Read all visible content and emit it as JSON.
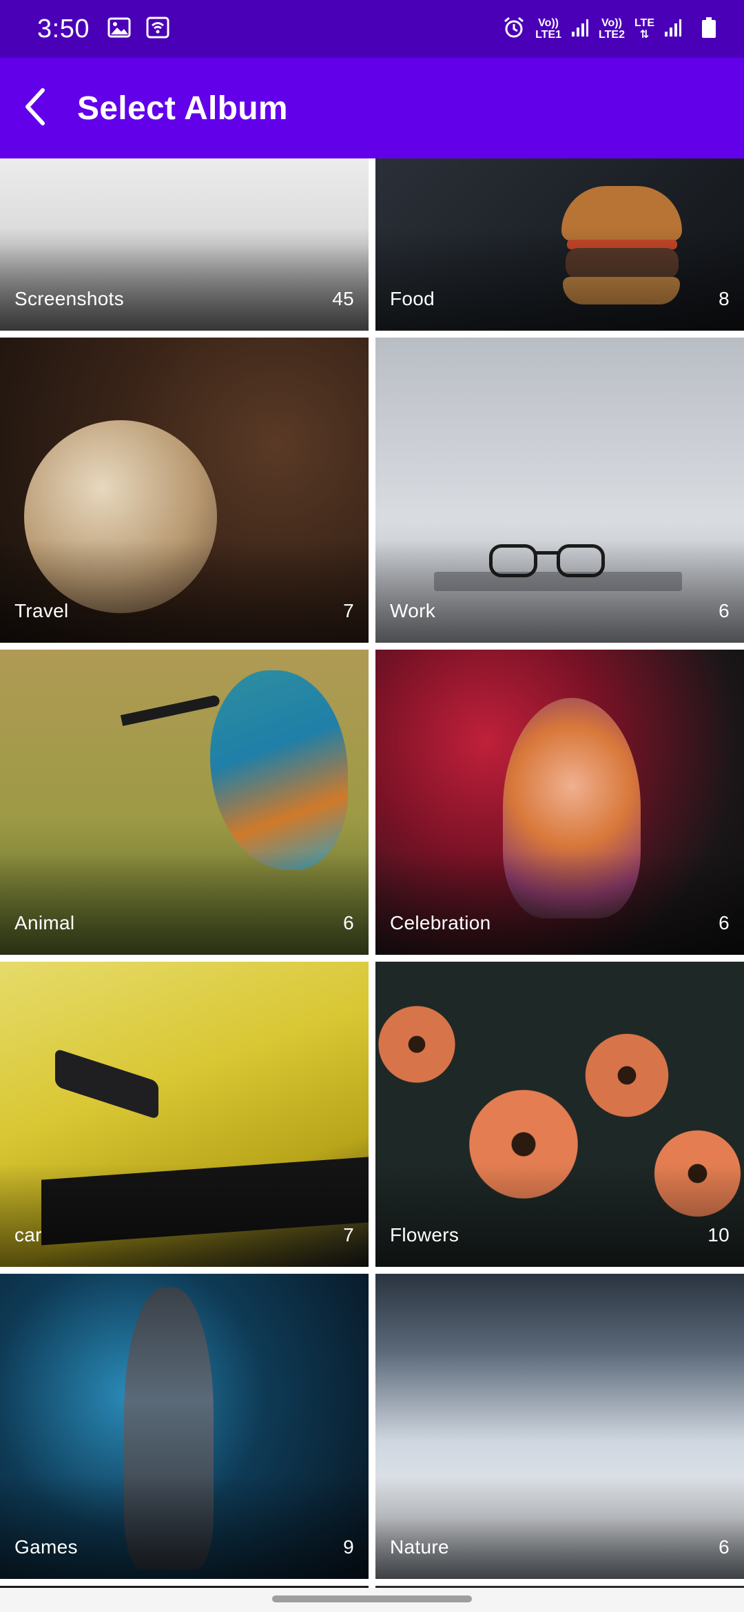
{
  "status_bar": {
    "time": "3:50",
    "icons": [
      "image-icon",
      "wifi-call-icon",
      "alarm-icon",
      "signal-icon",
      "battery-icon"
    ],
    "sim1": {
      "top": "Vo))",
      "bottom": "LTE1"
    },
    "sim2": {
      "top": "Vo))",
      "bottom": "LTE2"
    },
    "network": "LTE"
  },
  "app_bar": {
    "title": "Select Album",
    "back_icon": "arrow-back-icon",
    "color": "#6200ea"
  },
  "albums": [
    {
      "name": "Screenshots",
      "count": "45"
    },
    {
      "name": "Food",
      "count": "8"
    },
    {
      "name": "Travel",
      "count": "7"
    },
    {
      "name": "Work",
      "count": "6"
    },
    {
      "name": "Animal",
      "count": "6"
    },
    {
      "name": "Celebration",
      "count": "6"
    },
    {
      "name": "car",
      "count": "7"
    },
    {
      "name": "Flowers",
      "count": "10"
    },
    {
      "name": "Games",
      "count": "9"
    },
    {
      "name": "Nature",
      "count": "6"
    }
  ]
}
